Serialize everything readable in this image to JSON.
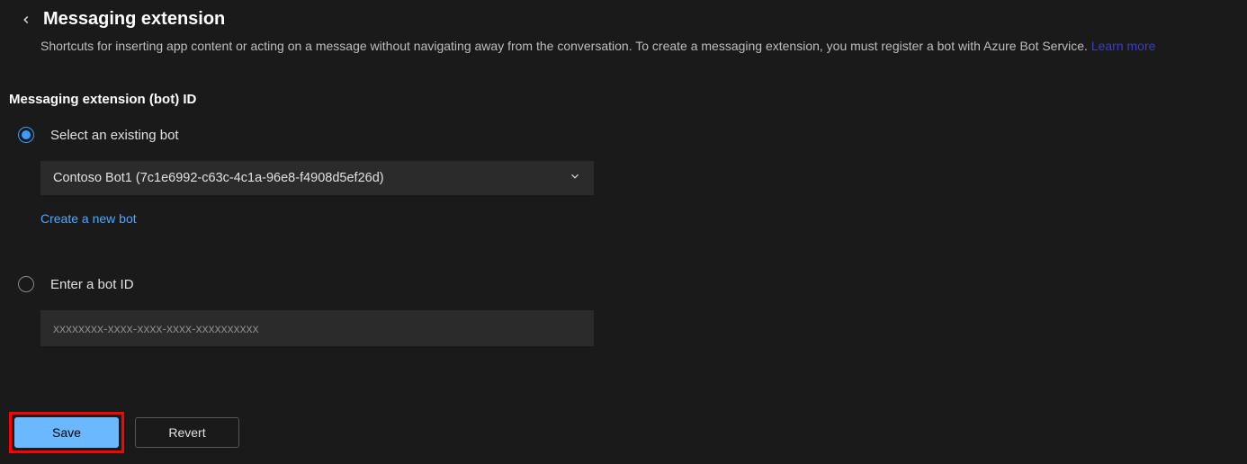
{
  "header": {
    "title": "Messaging extension",
    "description": "Shortcuts for inserting app content or acting on a message without navigating away from the conversation. To create a messaging extension, you must register a bot with Azure Bot Service. ",
    "learn_more": "Learn more"
  },
  "section": {
    "title": "Messaging extension (bot) ID"
  },
  "option_existing": {
    "label": "Select an existing bot",
    "selected_value": "Contoso Bot1 (7c1e6992-c63c-4c1a-96e8-f4908d5ef26d)",
    "create_link": "Create a new bot"
  },
  "option_enter": {
    "label": "Enter a bot ID",
    "placeholder": "xxxxxxxx-xxxx-xxxx-xxxx-xxxxxxxxxx"
  },
  "buttons": {
    "save": "Save",
    "revert": "Revert"
  }
}
